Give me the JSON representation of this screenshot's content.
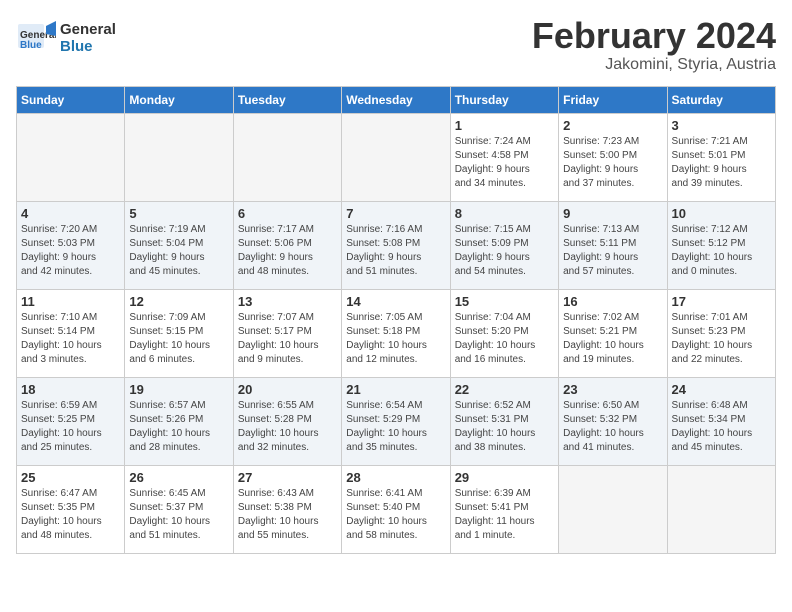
{
  "header": {
    "logo_general": "General",
    "logo_blue": "Blue",
    "month": "February 2024",
    "location": "Jakomini, Styria, Austria"
  },
  "weekdays": [
    "Sunday",
    "Monday",
    "Tuesday",
    "Wednesday",
    "Thursday",
    "Friday",
    "Saturday"
  ],
  "weeks": [
    [
      {
        "day": "",
        "info": ""
      },
      {
        "day": "",
        "info": ""
      },
      {
        "day": "",
        "info": ""
      },
      {
        "day": "",
        "info": ""
      },
      {
        "day": "1",
        "info": "Sunrise: 7:24 AM\nSunset: 4:58 PM\nDaylight: 9 hours\nand 34 minutes."
      },
      {
        "day": "2",
        "info": "Sunrise: 7:23 AM\nSunset: 5:00 PM\nDaylight: 9 hours\nand 37 minutes."
      },
      {
        "day": "3",
        "info": "Sunrise: 7:21 AM\nSunset: 5:01 PM\nDaylight: 9 hours\nand 39 minutes."
      }
    ],
    [
      {
        "day": "4",
        "info": "Sunrise: 7:20 AM\nSunset: 5:03 PM\nDaylight: 9 hours\nand 42 minutes."
      },
      {
        "day": "5",
        "info": "Sunrise: 7:19 AM\nSunset: 5:04 PM\nDaylight: 9 hours\nand 45 minutes."
      },
      {
        "day": "6",
        "info": "Sunrise: 7:17 AM\nSunset: 5:06 PM\nDaylight: 9 hours\nand 48 minutes."
      },
      {
        "day": "7",
        "info": "Sunrise: 7:16 AM\nSunset: 5:08 PM\nDaylight: 9 hours\nand 51 minutes."
      },
      {
        "day": "8",
        "info": "Sunrise: 7:15 AM\nSunset: 5:09 PM\nDaylight: 9 hours\nand 54 minutes."
      },
      {
        "day": "9",
        "info": "Sunrise: 7:13 AM\nSunset: 5:11 PM\nDaylight: 9 hours\nand 57 minutes."
      },
      {
        "day": "10",
        "info": "Sunrise: 7:12 AM\nSunset: 5:12 PM\nDaylight: 10 hours\nand 0 minutes."
      }
    ],
    [
      {
        "day": "11",
        "info": "Sunrise: 7:10 AM\nSunset: 5:14 PM\nDaylight: 10 hours\nand 3 minutes."
      },
      {
        "day": "12",
        "info": "Sunrise: 7:09 AM\nSunset: 5:15 PM\nDaylight: 10 hours\nand 6 minutes."
      },
      {
        "day": "13",
        "info": "Sunrise: 7:07 AM\nSunset: 5:17 PM\nDaylight: 10 hours\nand 9 minutes."
      },
      {
        "day": "14",
        "info": "Sunrise: 7:05 AM\nSunset: 5:18 PM\nDaylight: 10 hours\nand 12 minutes."
      },
      {
        "day": "15",
        "info": "Sunrise: 7:04 AM\nSunset: 5:20 PM\nDaylight: 10 hours\nand 16 minutes."
      },
      {
        "day": "16",
        "info": "Sunrise: 7:02 AM\nSunset: 5:21 PM\nDaylight: 10 hours\nand 19 minutes."
      },
      {
        "day": "17",
        "info": "Sunrise: 7:01 AM\nSunset: 5:23 PM\nDaylight: 10 hours\nand 22 minutes."
      }
    ],
    [
      {
        "day": "18",
        "info": "Sunrise: 6:59 AM\nSunset: 5:25 PM\nDaylight: 10 hours\nand 25 minutes."
      },
      {
        "day": "19",
        "info": "Sunrise: 6:57 AM\nSunset: 5:26 PM\nDaylight: 10 hours\nand 28 minutes."
      },
      {
        "day": "20",
        "info": "Sunrise: 6:55 AM\nSunset: 5:28 PM\nDaylight: 10 hours\nand 32 minutes."
      },
      {
        "day": "21",
        "info": "Sunrise: 6:54 AM\nSunset: 5:29 PM\nDaylight: 10 hours\nand 35 minutes."
      },
      {
        "day": "22",
        "info": "Sunrise: 6:52 AM\nSunset: 5:31 PM\nDaylight: 10 hours\nand 38 minutes."
      },
      {
        "day": "23",
        "info": "Sunrise: 6:50 AM\nSunset: 5:32 PM\nDaylight: 10 hours\nand 41 minutes."
      },
      {
        "day": "24",
        "info": "Sunrise: 6:48 AM\nSunset: 5:34 PM\nDaylight: 10 hours\nand 45 minutes."
      }
    ],
    [
      {
        "day": "25",
        "info": "Sunrise: 6:47 AM\nSunset: 5:35 PM\nDaylight: 10 hours\nand 48 minutes."
      },
      {
        "day": "26",
        "info": "Sunrise: 6:45 AM\nSunset: 5:37 PM\nDaylight: 10 hours\nand 51 minutes."
      },
      {
        "day": "27",
        "info": "Sunrise: 6:43 AM\nSunset: 5:38 PM\nDaylight: 10 hours\nand 55 minutes."
      },
      {
        "day": "28",
        "info": "Sunrise: 6:41 AM\nSunset: 5:40 PM\nDaylight: 10 hours\nand 58 minutes."
      },
      {
        "day": "29",
        "info": "Sunrise: 6:39 AM\nSunset: 5:41 PM\nDaylight: 11 hours\nand 1 minute."
      },
      {
        "day": "",
        "info": ""
      },
      {
        "day": "",
        "info": ""
      }
    ]
  ]
}
